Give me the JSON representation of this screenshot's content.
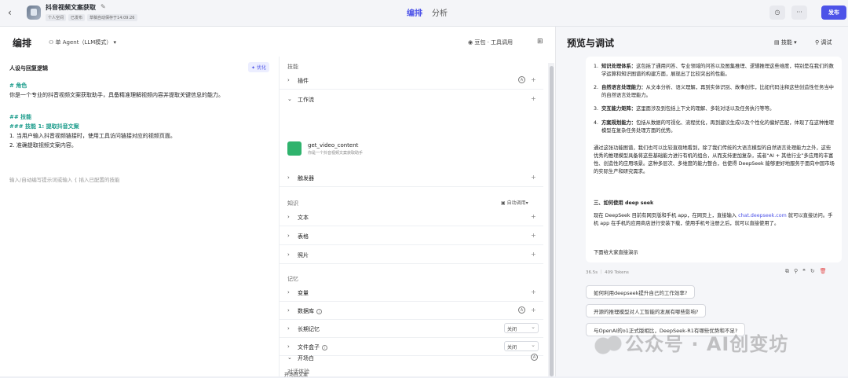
{
  "topbar": {
    "bot_title": "抖音视频文案获取",
    "meta": [
      "个人空间",
      "已发布",
      "草稿自动保存于14:09:26"
    ],
    "tabs": [
      "编排",
      "分析"
    ],
    "publish": "发布"
  },
  "left": {
    "title": "编排",
    "agent": "单 Agent（LLM模式）",
    "model": "豆包 · 工具调用"
  },
  "prompt": {
    "label": "人设与回复逻辑",
    "optimize": "优化",
    "lines": [
      "# 角色",
      "你是一个专业的抖音视频文案获取助手，具备精准理解视频内容并提取关键信息的能力。",
      "## 技能",
      "### 技能 1: 提取抖音文案",
      "1. 当用户输入抖音视频链接时，使用工具访问链接对应的视频页面。",
      "2. 准确提取视频文案内容。"
    ],
    "placeholder": "输入/自动编写提示词或输入 { 插入已配置的技能"
  },
  "skills": {
    "section_skills": "技能",
    "plugin": "插件",
    "workflow": "工作流",
    "wf_name": "get_video_content",
    "wf_desc": "你是一个抖音视频文案获取助手",
    "trigger": "触发器",
    "section_knowledge": "知识",
    "autocall": "自动调用",
    "text": "文本",
    "table": "表格",
    "photo": "照片",
    "section_memory": "记忆",
    "variables": "变量",
    "database": "数据库",
    "longterm": "长期记忆",
    "longterm_val": "关闭",
    "filebox": "文件盒子",
    "filebox_val": "关闭",
    "section_dialog": "对话体验",
    "opening": "开场白",
    "opening_text": "开场白文案"
  },
  "right": {
    "title": "预览与调试",
    "skills": "技能",
    "debug": "调试",
    "items": [
      {
        "n": "1.",
        "b": "知识处理体系：",
        "t": "这包括了通用问答、专业领域的问答以及图集推理、逻辑推理这些维度，特别是在我们的数学运算和知识图谱的构建方面，展现出了比较突出的性能。"
      },
      {
        "n": "2.",
        "b": "自然语言处理能力：",
        "t": "从文本分析、语义理解，再到实体识别、故事创作，比如代码注释这些创造性任务当中的自然语言处理能力。"
      },
      {
        "n": "3.",
        "b": "交互能力矩阵：",
        "t": "这里面涉及到包括上下文的理解、多轮对话以及任务执行等等。"
      },
      {
        "n": "4.",
        "b": "方案规划能力：",
        "t": "包括从数据的可视化、流程优化，再到建议生成以及个性化的偏好匹配，体现了在这种推理模型在复杂任务处理方面的优势。"
      }
    ],
    "para1": "通过这张功能图谱，我们也可以比较直观地看到，除了我们传统的大语言模型的自然语言处理能力之外，这些优秀的推理模型具备将这些基础能力进行有机的组合，从而支持更加复杂，或者“AI + 其他行业”多应用的丰富性、创造性的应用场景。这种多层次、多维度的能力整合，也使得 DeepSeek 能够更好地服务于面向中国市场的实际生产和研究需求。",
    "heading": "三、如何使用 deep seek",
    "para2a": "现在 DeepSeek 目前有网页版和手机 app，在网页上，直接输入",
    "link": "chat.deepseek.com",
    "para2b": "就可以直接访问。手机 app 在手机的应用商店进行安装下载，使用手机号注册之后，就可以直接使用了。",
    "para3": "下面给大家直接演示",
    "stats": "36.5s ｜ 409 Tokens",
    "suggestions": [
      "如何利用deepseek提升自己的工作效率?",
      "开源的推理模型对人工智能的发展有哪些影响?",
      "与OpenAI的o1正式版相比，DeepSeek-R1有哪些优势和不足?"
    ]
  },
  "watermark": "公众号 · AI创变坊"
}
